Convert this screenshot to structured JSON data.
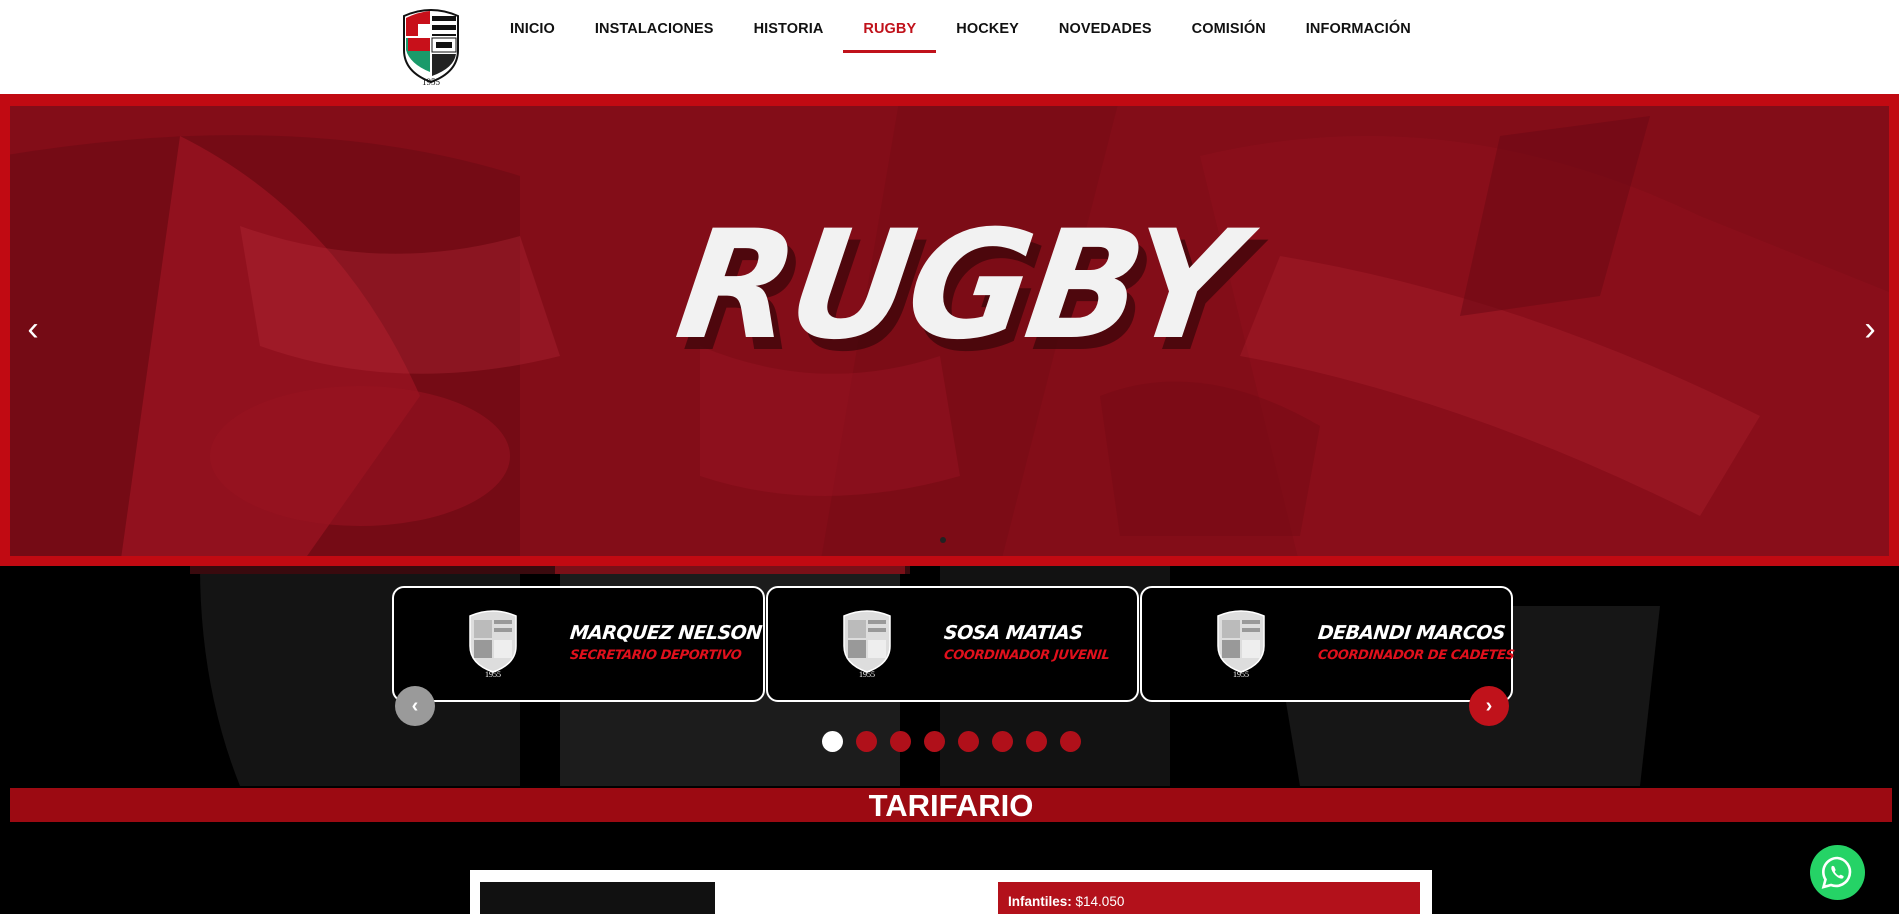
{
  "header": {
    "logo_year": "1955",
    "nav": [
      {
        "label": "INICIO",
        "active": false
      },
      {
        "label": "INSTALACIONES",
        "active": false
      },
      {
        "label": "HISTORIA",
        "active": false
      },
      {
        "label": "RUGBY",
        "active": true
      },
      {
        "label": "HOCKEY",
        "active": false
      },
      {
        "label": "NOVEDADES",
        "active": false
      },
      {
        "label": "COMISIÓN",
        "active": false
      },
      {
        "label": "INFORMACIÓN",
        "active": false
      }
    ]
  },
  "hero": {
    "title": "RUGBY",
    "prev_icon": "chevron-left-icon",
    "next_icon": "chevron-right-icon",
    "prev_glyph": "‹",
    "next_glyph": "›"
  },
  "staff": {
    "cards": [
      {
        "name": "MARQUEZ NELSON",
        "role": "SECRETARIO DEPORTIVO",
        "year": "1955"
      },
      {
        "name": "SOSA MATIAS",
        "role": "COORDINADOR JUVENIL",
        "year": "1955"
      },
      {
        "name": "DEBANDI MARCOS",
        "role": "COORDINADOR DE CADETES",
        "year": "1955"
      }
    ],
    "prev_glyph": "‹",
    "next_glyph": "›",
    "pages": 8,
    "active_page": 1
  },
  "tarifario": {
    "title": "TARIFARIO",
    "first_item_label": "Infantiles:",
    "first_item_price": "$14.050"
  },
  "colors": {
    "brand_red": "#c0121b",
    "dark_red": "#9c0a12",
    "whatsapp_green": "#25d366"
  }
}
